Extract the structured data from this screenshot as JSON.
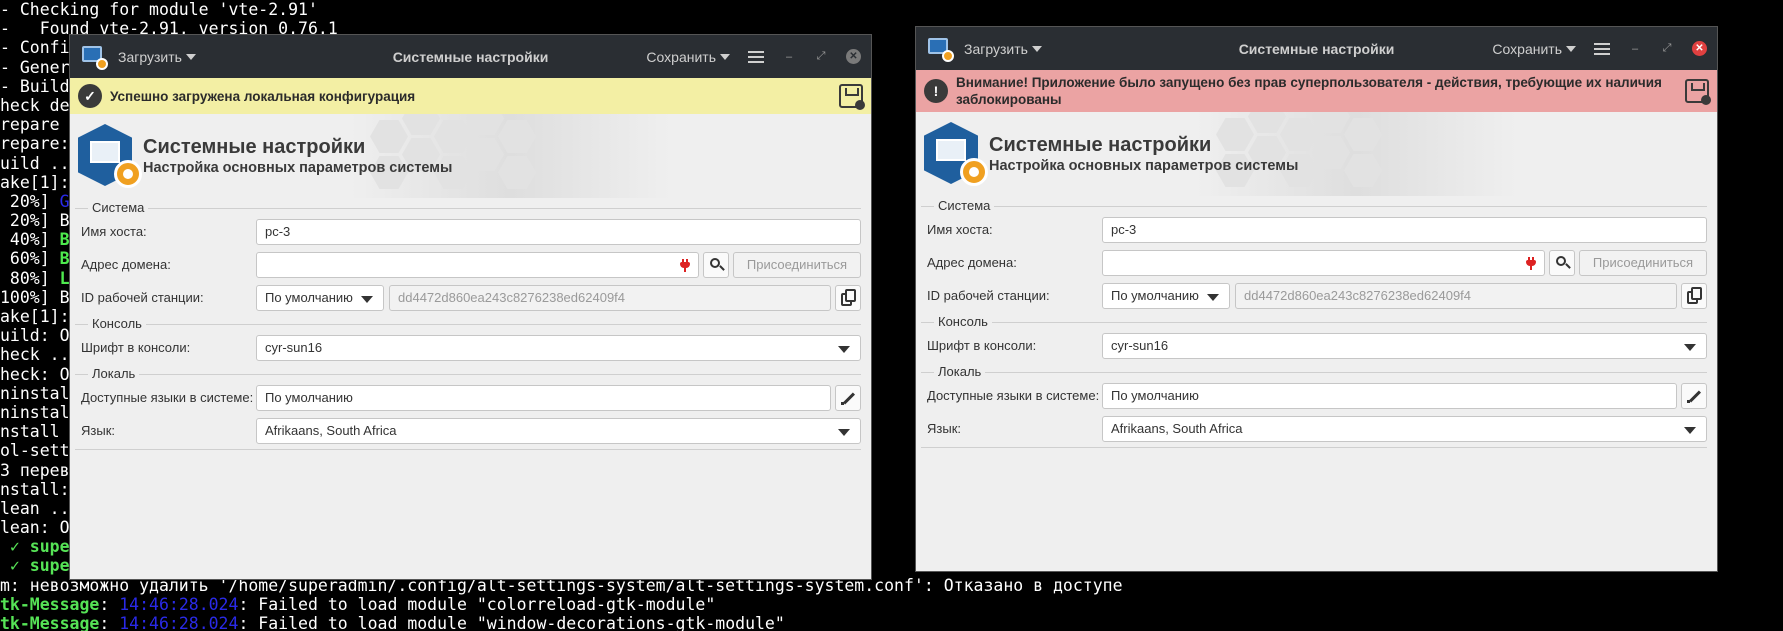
{
  "terminal": {
    "lines": [
      [
        {
          "t": "- Checking for module 'vte-2.91'"
        }
      ],
      [
        {
          "t": "-   Found vte-2.91, version 0.76.1"
        }
      ],
      [
        {
          "t": "- Confi"
        }
      ],
      [
        {
          "t": "- Gener"
        }
      ],
      [
        {
          "t": "- Build"
        }
      ],
      [
        {
          "t": "heck de"
        }
      ],
      [
        {
          "t": "repare "
        }
      ],
      [
        {
          "t": "repare:"
        }
      ],
      [
        {
          "t": "uild .."
        }
      ],
      [
        {
          "t": "ake[1]:"
        }
      ],
      [
        {
          "t": " 20%] "
        },
        {
          "t": "G",
          "c": "t-blue"
        }
      ],
      [
        {
          "t": " 20%] B"
        }
      ],
      [
        {
          "t": " 40%] "
        },
        {
          "t": "B",
          "c": "t-green"
        }
      ],
      [
        {
          "t": " 60%] "
        },
        {
          "t": "B",
          "c": "t-green"
        }
      ],
      [
        {
          "t": " 80%] "
        },
        {
          "t": "L",
          "c": "t-green"
        }
      ],
      [
        {
          "t": "100%] B"
        }
      ],
      [
        {
          "t": "ake[1]:"
        }
      ],
      [
        {
          "t": "uild: O"
        }
      ],
      [
        {
          "t": "heck .."
        }
      ],
      [
        {
          "t": "heck: O"
        }
      ],
      [
        {
          "t": "ninstal"
        }
      ],
      [
        {
          "t": "ninstal"
        }
      ],
      [
        {
          "t": "nstall "
        }
      ],
      [
        {
          "t": "ol-sett"
        }
      ],
      [
        {
          "t": "3 перев"
        }
      ],
      [
        {
          "t": "nstall:"
        }
      ],
      [
        {
          "t": "lean .."
        }
      ],
      [
        {
          "t": "lean: O"
        }
      ],
      [
        {
          "t": " ✓ supe",
          "c": "t-gb"
        }
      ],
      [
        {
          "t": " ✓ supe",
          "c": "t-gb"
        }
      ],
      [
        {
          "t": "m: невозможно удалить '/home/superadmin/.config/alt-settings-system/alt-settings-system.conf': Отказано в доступе"
        }
      ],
      [
        {
          "t": "tk-Message",
          "c": "t-gb"
        },
        {
          "t": ": "
        },
        {
          "t": "14:46:28.024",
          "c": "t-blue"
        },
        {
          "t": ": Failed to load module \"colorreload-gtk-module\""
        }
      ],
      [
        {
          "t": "tk-Message",
          "c": "t-gb"
        },
        {
          "t": ": "
        },
        {
          "t": "14:46:28.024",
          "c": "t-blue"
        },
        {
          "t": ": Failed to load module \"window-decorations-gtk-module\""
        }
      ]
    ]
  },
  "common": {
    "load_label": "Загрузить",
    "window_title": "Системные настройки",
    "save_label": "Сохранить",
    "banner_title": "Системные настройки",
    "banner_subtitle": "Настройка основных параметров системы",
    "group_system": "Система",
    "hostname_label": "Имя хоста:",
    "hostname_value": "pc-3",
    "domain_label": "Адрес домена:",
    "domain_value": "",
    "join_label": "Присоединиться",
    "workstation_label": "ID рабочей станции:",
    "workstation_mode": "По умолчанию",
    "workstation_id": "dd4472d860ea243c8276238ed62409f4",
    "group_console": "Консоль",
    "font_label": "Шрифт в консоли:",
    "font_value": "cyr-sun16",
    "group_locale": "Локаль",
    "languages_label": "Доступные языки в системе:",
    "languages_value": "По умолчанию",
    "language_label": "Язык:",
    "language_value": "Afrikaans, South Africa"
  },
  "window1": {
    "info_message": "Успешно загружена локальная конфигурация",
    "info_color": "#f3efa4"
  },
  "window2": {
    "info_message": "Внимание! Приложение было запущено без прав суперпользователя - действия, требующие их наличия заблокированы",
    "info_color": "#eba3a3"
  },
  "colors": {
    "titlebar": "#2a2e33",
    "window_bg": "#efefef",
    "close_active": "#e04040"
  }
}
